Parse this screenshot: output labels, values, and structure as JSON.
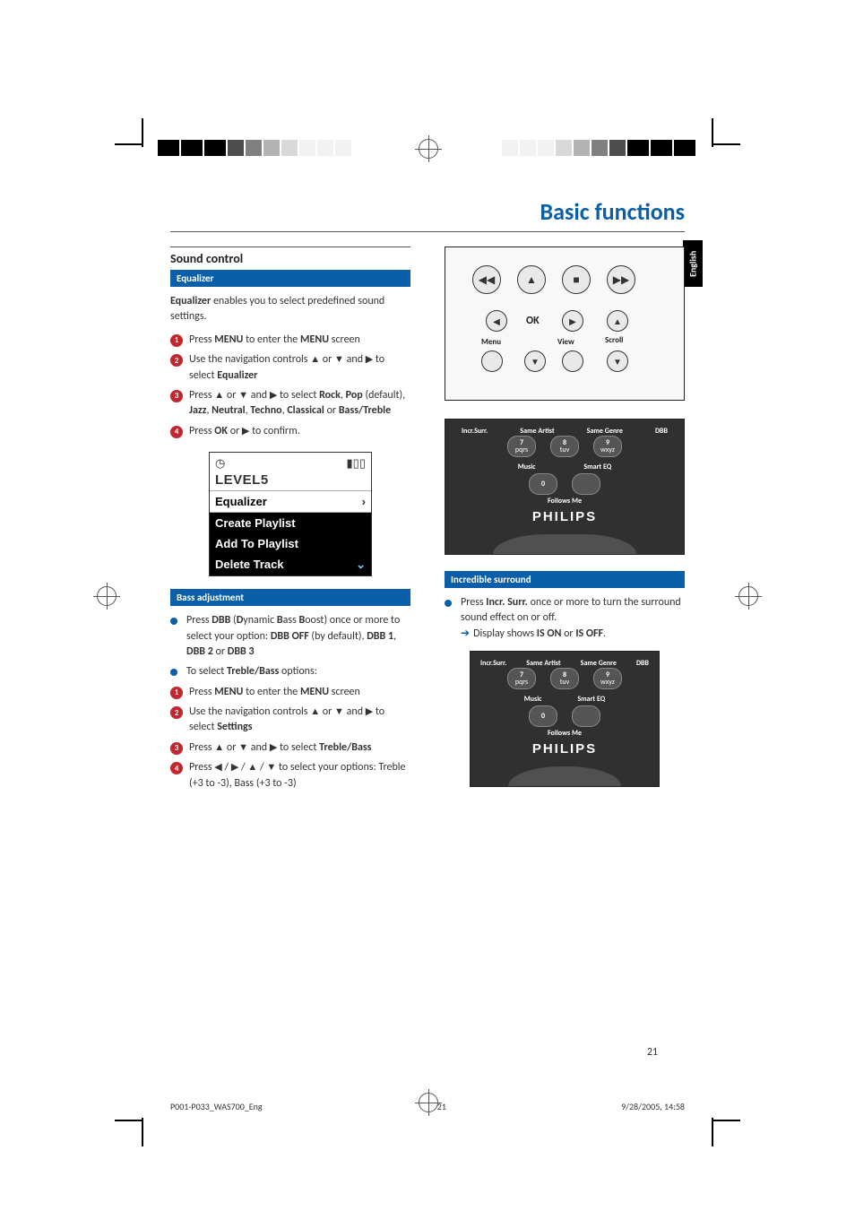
{
  "page": {
    "title": "Basic functions",
    "language_tab": "English",
    "page_number": "21"
  },
  "left": {
    "section_heading": "Sound control",
    "equalizer": {
      "header": "Equalizer",
      "intro_bold": "Equalizer",
      "intro_rest": " enables you to select predefined sound settings.",
      "step1_a": "Press ",
      "step1_menu": "MENU",
      "step1_b": " to enter the ",
      "step1_menu2": "MENU",
      "step1_c": " screen",
      "step2_a": "Use the navigation controls ",
      "step2_b": " or ",
      "step2_c": " and ",
      "step2_d": " to select ",
      "step2_eq": "Equalizer",
      "step3_a": "Press ",
      "step3_b": " or ",
      "step3_c": " and ",
      "step3_d": " to  select ",
      "step3_rock": "Rock",
      "step3_sep1": ", ",
      "step3_pop": "Pop",
      "step3_def": " (default), ",
      "step3_jazz": "Jazz",
      "step3_sep2": ",  ",
      "step3_neutral": "Neutral",
      "step3_sep3": ", ",
      "step3_techno": "Techno",
      "step3_sep4": ", ",
      "step3_classical": "Classical",
      "step3_or": " or ",
      "step3_basstreble": "Bass/Treble",
      "step4_a": "Press ",
      "step4_ok": "OK",
      "step4_b": " or  ",
      "step4_c": "  to confirm."
    },
    "screen": {
      "level": "LEVEL5",
      "row_selected": "Equalizer",
      "rows": [
        "Create Playlist",
        "Add To Playlist",
        "Delete Track"
      ]
    },
    "bass": {
      "header": "Bass adjustment",
      "b1_a": "Press ",
      "b1_dbb": "DBB",
      "b1_paren_open": " (",
      "b1_D": "D",
      "b1_ynamic": "ynamic ",
      "b1_B1": "B",
      "b1_ass": "ass ",
      "b1_B2": "B",
      "b1_oost": "oost) once or more to select your option: ",
      "b1_off": "DBB OFF",
      "b1_by": " (by default), ",
      "b1_1": "DBB 1",
      "b1_sep1": ", ",
      "b1_2": "DBB 2",
      "b1_or": " or   ",
      "b1_3": "DBB 3",
      "b2_a": "To select ",
      "b2_tb": "Treble/Bass",
      "b2_b": " options:",
      "s1_a": "Press ",
      "s1_menu": "MENU",
      "s1_b": " to enter the ",
      "s1_menu2": "MENU",
      "s1_c": " screen",
      "s2_a": "Use the navigation controls ",
      "s2_b": "  or  ",
      "s2_c": "  and ",
      "s2_d": " to select ",
      "s2_settings": "Settings",
      "s3_a": "Press ",
      "s3_b": "  or  ",
      "s3_c": "  and ",
      "s3_d": " to  select ",
      "s3_tb": "Treble/Bass",
      "s4_a": "Press ",
      "s4_b": " / ",
      "s4_c": " / ",
      "s4_d": " / ",
      "s4_e": "  to  select  your options: Treble (+3 to -3), Bass (+3 to -3)"
    }
  },
  "right": {
    "remote_labels": {
      "ok": "OK",
      "menu": "Menu",
      "view": "View",
      "scroll": "Scroll"
    },
    "keypad": {
      "top_labels": [
        "Incr.Surr.",
        "Same Artist",
        "Same Genre",
        "DBB"
      ],
      "row1": [
        {
          "n": "7",
          "t": "pqrs"
        },
        {
          "n": "8",
          "t": "tuv"
        },
        {
          "n": "9",
          "t": "wxyz"
        }
      ],
      "mid_labels": [
        "Music",
        "Smart EQ"
      ],
      "row2": [
        {
          "n": "0",
          "t": ""
        }
      ],
      "follows": "Follows Me",
      "brand": "PHILIPS"
    },
    "surround": {
      "header": "Incredible surround",
      "line1_a": "Press ",
      "line1_incr": "Incr. Surr.",
      "line1_b": "  once or more to turn the surround sound effect on or off.",
      "result_a": "Display shows ",
      "result_on": "IS ON",
      "result_or": " or ",
      "result_off": "IS OFF",
      "result_dot": "."
    }
  },
  "footer": {
    "file": "P001-P033_WAS700_Eng",
    "sheetpage": "21",
    "datetime": "9/28/2005, 14:58"
  }
}
